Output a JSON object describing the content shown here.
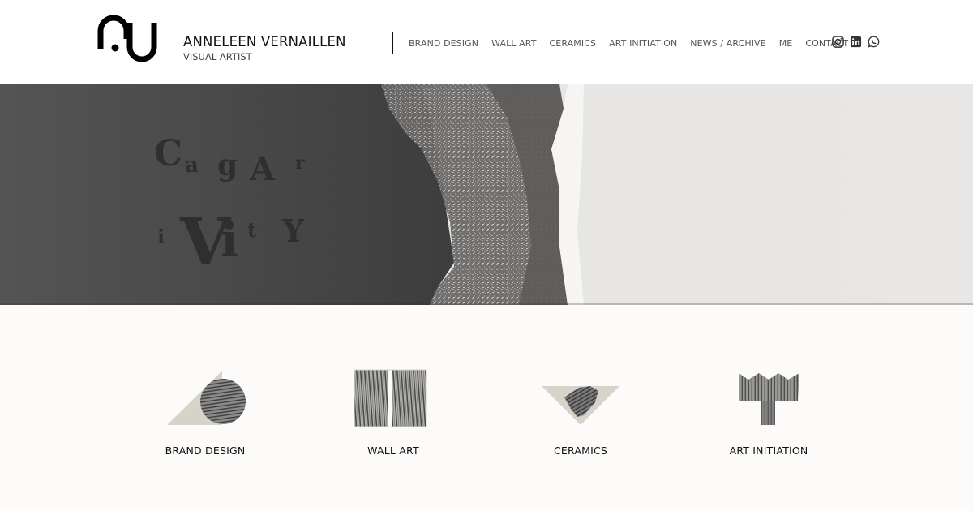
{
  "header": {
    "brand_name": "ANNELEEN VERNAILLEN",
    "brand_subtitle": "VISUAL ARTIST",
    "nav": [
      {
        "label": "BRAND DESIGN"
      },
      {
        "label": "WALL ART"
      },
      {
        "label": "CERAMICS"
      },
      {
        "label": "ART INITIATION"
      },
      {
        "label": "NEWS / ARCHIVE"
      },
      {
        "label": "ME"
      },
      {
        "label": "CONTACT"
      }
    ],
    "socials": [
      "instagram-icon",
      "linkedin-icon",
      "whatsapp-icon"
    ]
  },
  "hero": {
    "wall_letters": [
      "C",
      "a",
      "g",
      "A",
      "r",
      "i",
      "V",
      "i",
      "t",
      "Y"
    ]
  },
  "categories": [
    {
      "label": "BRAND DESIGN",
      "icon": "brand-design-icon"
    },
    {
      "label": "WALL ART",
      "icon": "wall-art-icon"
    },
    {
      "label": "CERAMICS",
      "icon": "ceramics-icon"
    },
    {
      "label": "ART INITIATION",
      "icon": "art-initiation-icon"
    }
  ],
  "colors": {
    "page_background": "#fcfbf9",
    "header_background": "#ffffff",
    "text": "#111111",
    "nav_text": "#555555",
    "hero_dark": "#4a4949",
    "hero_light": "#e9e8e6",
    "icon_beige": "#d6d3ca",
    "icon_hatch": "#5a5a5a"
  }
}
